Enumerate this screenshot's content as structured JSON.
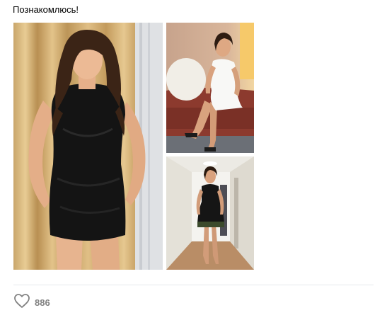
{
  "post": {
    "text": "Познакомлюсь!"
  },
  "photos": [
    {
      "label": "photo-1",
      "icon": "photo-woman-black-dress"
    },
    {
      "label": "photo-2",
      "icon": "photo-woman-white-dress-sofa"
    },
    {
      "label": "photo-3",
      "icon": "photo-woman-hallway"
    }
  ],
  "actions": {
    "like_icon": "heart-icon",
    "like_count": "886"
  },
  "colors": {
    "text": "#000000",
    "muted": "#828282",
    "divider": "#e7e8ec"
  }
}
